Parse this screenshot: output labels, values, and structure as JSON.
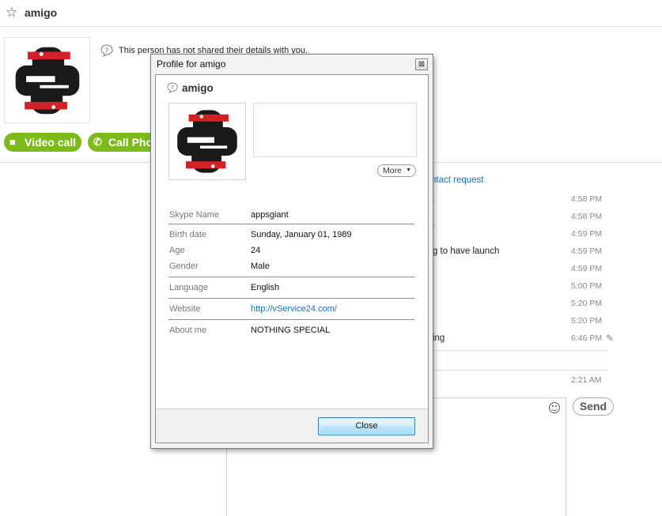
{
  "header": {
    "contact_name": "amigo",
    "favorite_icon": "star-outline-icon"
  },
  "profile_notice": {
    "icon": "info-question-icon",
    "text": "This person has not shared their details with you."
  },
  "actions": {
    "video_call": {
      "label": "Video call",
      "icon": "video-camera-icon"
    },
    "call_phone": {
      "label": "Call Pho",
      "icon": "phone-icon"
    }
  },
  "conversation": {
    "contact_request_fragment": "ntact request",
    "timestamps": [
      "4:58 PM",
      "4:58 PM",
      "4:59 PM",
      "4:59 PM",
      "4:59 PM",
      "5:00 PM",
      "5:20 PM",
      "5:20 PM",
      "6:46 PM",
      "2:21 AM"
    ],
    "fragments": [
      "ing to have launch",
      "cting"
    ],
    "send_label": "Send",
    "emoji_icon": "smiley-icon"
  },
  "dialog": {
    "title": "Profile for amigo",
    "close_x": "⊠",
    "name": "amigo",
    "more_label": "More",
    "fields": {
      "skype_name": {
        "label": "Skype Name",
        "value": "appsgiant"
      },
      "birth_date": {
        "label": "Birth date",
        "value": "Sunday, January 01, 1989"
      },
      "age": {
        "label": "Age",
        "value": "24"
      },
      "gender": {
        "label": "Gender",
        "value": "Male"
      },
      "language": {
        "label": "Language",
        "value": "English"
      },
      "website": {
        "label": "Website",
        "value": "http://vService24.com/"
      },
      "about_me": {
        "label": "About me",
        "value": "NOTHING SPECIAL"
      }
    },
    "close_label": "Close"
  },
  "colors": {
    "call_green": "#7cbb1a",
    "link_blue": "#1a6eb3",
    "avatar_red": "#d42127",
    "avatar_black": "#1a1a1a"
  }
}
